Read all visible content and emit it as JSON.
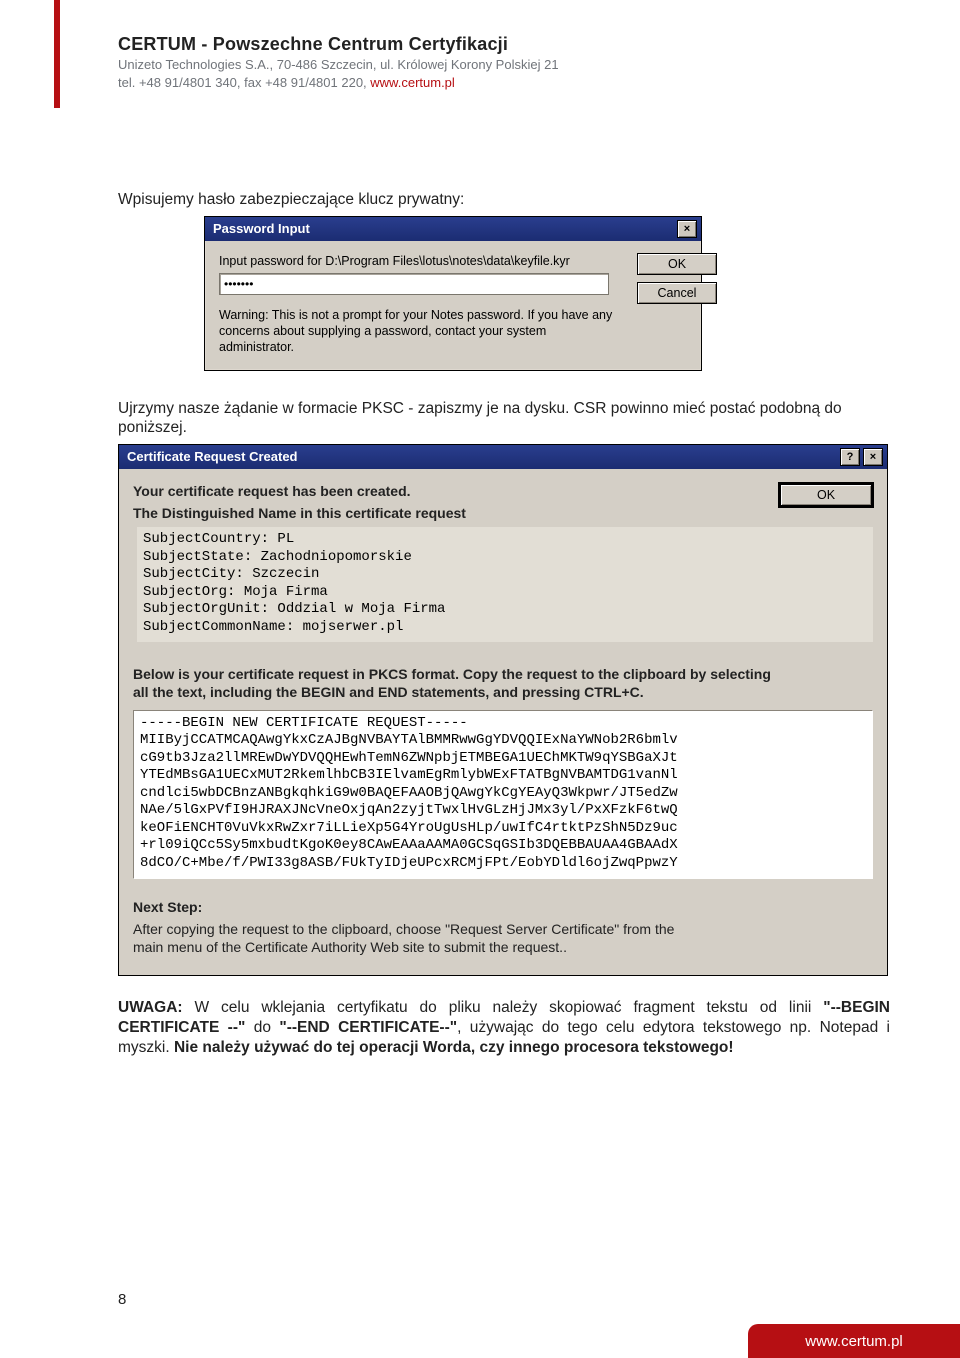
{
  "header": {
    "title": "CERTUM - Powszechne Centrum Certyfikacji",
    "addr": "Unizeto Technologies S.A., 70-486 Szczecin, ul. Królowej Korony Polskiej 21",
    "contact_prefix": "tel. +48 91/4801 340, fax +48 91/4801 220, ",
    "contact_link": "www.certum.pl"
  },
  "page": {
    "p1": "Wpisujemy hasło zabezpieczające klucz prywatny:",
    "p2": "Ujrzymy nasze żądanie w formacie PKSC - zapiszmy je na dysku. CSR powinno mieć postać podobną do poniższej.",
    "note_bold1": "UWAGA:",
    "note_t1": " W celu wklejania certyfikatu do pliku należy skopiować fragment tekstu od linii ",
    "note_bold2": "\"--BEGIN CERTIFICATE --\"",
    "note_t2": " do ",
    "note_bold3": "\"--END CERTIFICATE--\"",
    "note_t3": ", używając do tego celu edytora tekstowego np. Notepad i myszki. ",
    "note_bold4": "Nie należy używać do tej operacji Worda, czy innego procesora tekstowego!",
    "number": "8"
  },
  "pw_dialog": {
    "title": "Password Input",
    "prompt": "Input password for D:\\Program Files\\lotus\\notes\\data\\keyfile.kyr",
    "value": "xxxxxxx",
    "ok": "OK",
    "cancel": "Cancel",
    "warn": "Warning: This is not a prompt for your Notes password. If you have any concerns about supplying a password, contact your system administrator."
  },
  "csr_dialog": {
    "title": "Certificate Request Created",
    "ok": "OK",
    "heading": "Your certificate request has been created.",
    "dn_title": "The Distinguished Name in this certificate request",
    "dn_lines": "SubjectCountry: PL\nSubjectState: Zachodniopomorskie\nSubjectCity: Szczecin\nSubjectOrg: Moja Firma\nSubjectOrgUnit: Oddzial w Moja Firma\nSubjectCommonName: mojserwer.pl",
    "instr": "Below is your certificate request in PKCS format.  Copy the request to the clipboard by selecting all the text, including the BEGIN and END statements, and pressing CTRL+C.",
    "csr_text": "-----BEGIN NEW CERTIFICATE REQUEST-----\nMIIByjCCATMCAQAwgYkxCzAJBgNVBAYTAlBMMRwwGgYDVQQIExNaYWNob2R6bmlv\ncG9tb3Jza2llMREwDwYDVQQHEwhTemN6ZWNpbjETMBEGA1UEChMKTW9qYSBGaXJt\nYTEdMBsGA1UECxMUT2RkemlhbCB3IElvamEgRmlybWExFTATBgNVBAMTDG1vanNl\ncndlci5wbDCBnzANBgkqhkiG9w0BAQEFAAOBjQAwgYkCgYEAyQ3Wkpwr/JT5edZw\nNAe/5lGxPVfI9HJRAXJNcVneOxjqAn2zyjtTwxlHvGLzHjJMx3yl/PxXFzkF6twQ\nkeOFiENCHT0VuVkxRwZxr7iLLieXp5G4YroUgUsHLp/uwIfC4rtktPzShN5Dz9uc\n+rl09iQCc5Sy5mxbudtKgoK0ey8CAwEAAaAAMA0GCSqGSIb3DQEBBAUAA4GBAAdX\n8dCO/C+Mbe/f/PWI33g8ASB/FUkTyIDjeUPcxRCMjFPt/EobYDldl6ojZwqPpwzY",
    "next_label": "Next Step:",
    "next_text": "After copying the request to the clipboard, choose \"Request Server Certificate\" from the main menu of the Certificate Authority Web site to submit the request.."
  },
  "footer": {
    "url": "www.certum.pl"
  }
}
